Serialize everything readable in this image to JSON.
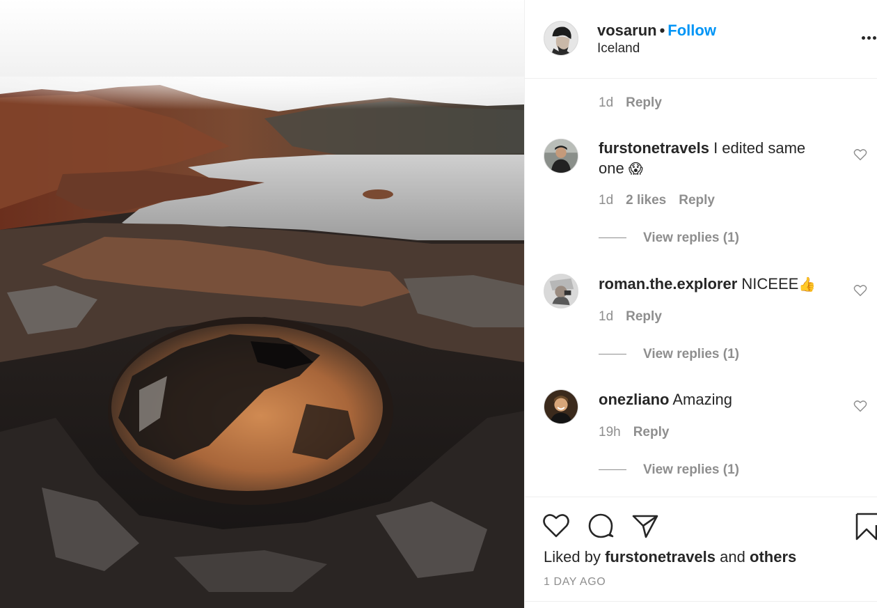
{
  "post": {
    "author": "vosarun",
    "dot": "•",
    "follow_label": "Follow",
    "location": "Iceland",
    "more_icon": "more-options-icon"
  },
  "comments": [
    {
      "time": "1d",
      "reply_label": "Reply"
    },
    {
      "username": "furstonetravels",
      "text": "I edited same one",
      "emoji": "😱",
      "time": "1d",
      "likes": "2 likes",
      "reply_label": "Reply",
      "view_replies": "View replies (1)"
    },
    {
      "username": "roman.the.explorer",
      "text": "NICEEE",
      "emoji": "👍",
      "time": "1d",
      "reply_label": "Reply",
      "view_replies": "View replies (1)"
    },
    {
      "username": "onezliano",
      "text": "Amazing",
      "time": "19h",
      "reply_label": "Reply",
      "view_replies": "View replies (1)"
    }
  ],
  "actions": {
    "like_icon": "heart-icon",
    "comment_icon": "comment-icon",
    "share_icon": "share-icon",
    "save_icon": "bookmark-icon"
  },
  "liked_by": {
    "prefix": "Liked by",
    "user": "furstonetravels",
    "and": "and",
    "others": "others"
  },
  "timestamp": "1 DAY AGO"
}
